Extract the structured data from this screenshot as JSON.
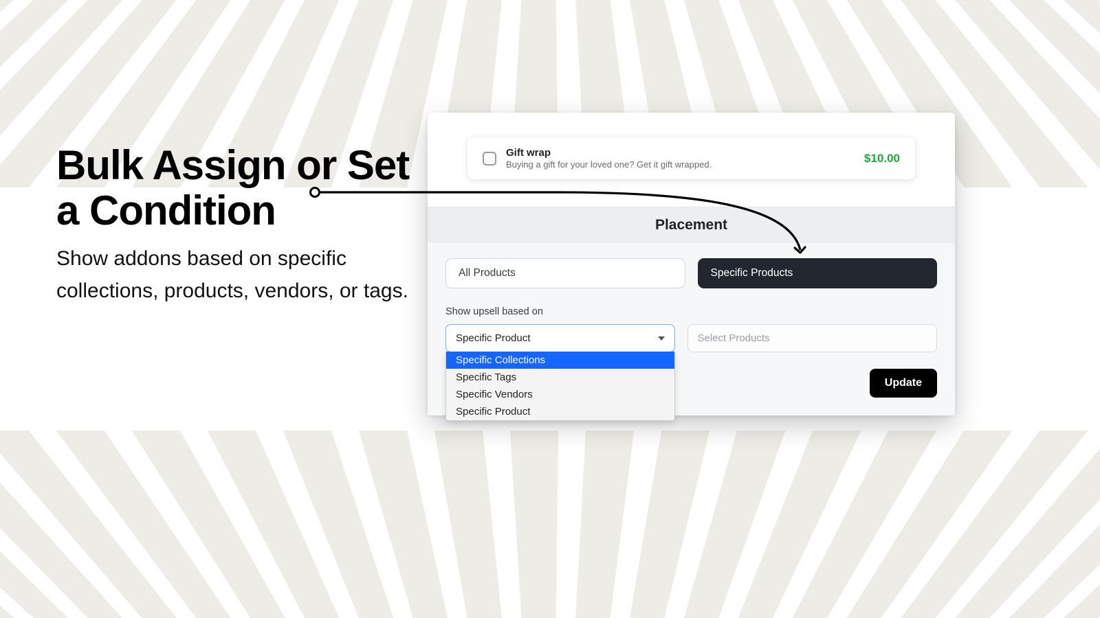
{
  "heading": {
    "title": "Bulk Assign or Set a Condition",
    "subtitle": "Show addons based on specific collections, products, vendors, or tags."
  },
  "addon": {
    "title": "Gift wrap",
    "description": "Buying a gift for your loved one? Get it gift wrapped.",
    "price": "$10.00"
  },
  "placement": {
    "section_title": "Placement",
    "segments": {
      "all": "All Products",
      "specific": "Specific Products"
    },
    "field_label": "Show upsell based on",
    "select_value": "Specific Product",
    "options": [
      "Specific Collections",
      "Specific Tags",
      "Specific Vendors",
      "Specific Product"
    ],
    "highlighted_option": "Specific Collections",
    "picker_placeholder": "Select Products"
  },
  "footer": {
    "update": "Update"
  }
}
